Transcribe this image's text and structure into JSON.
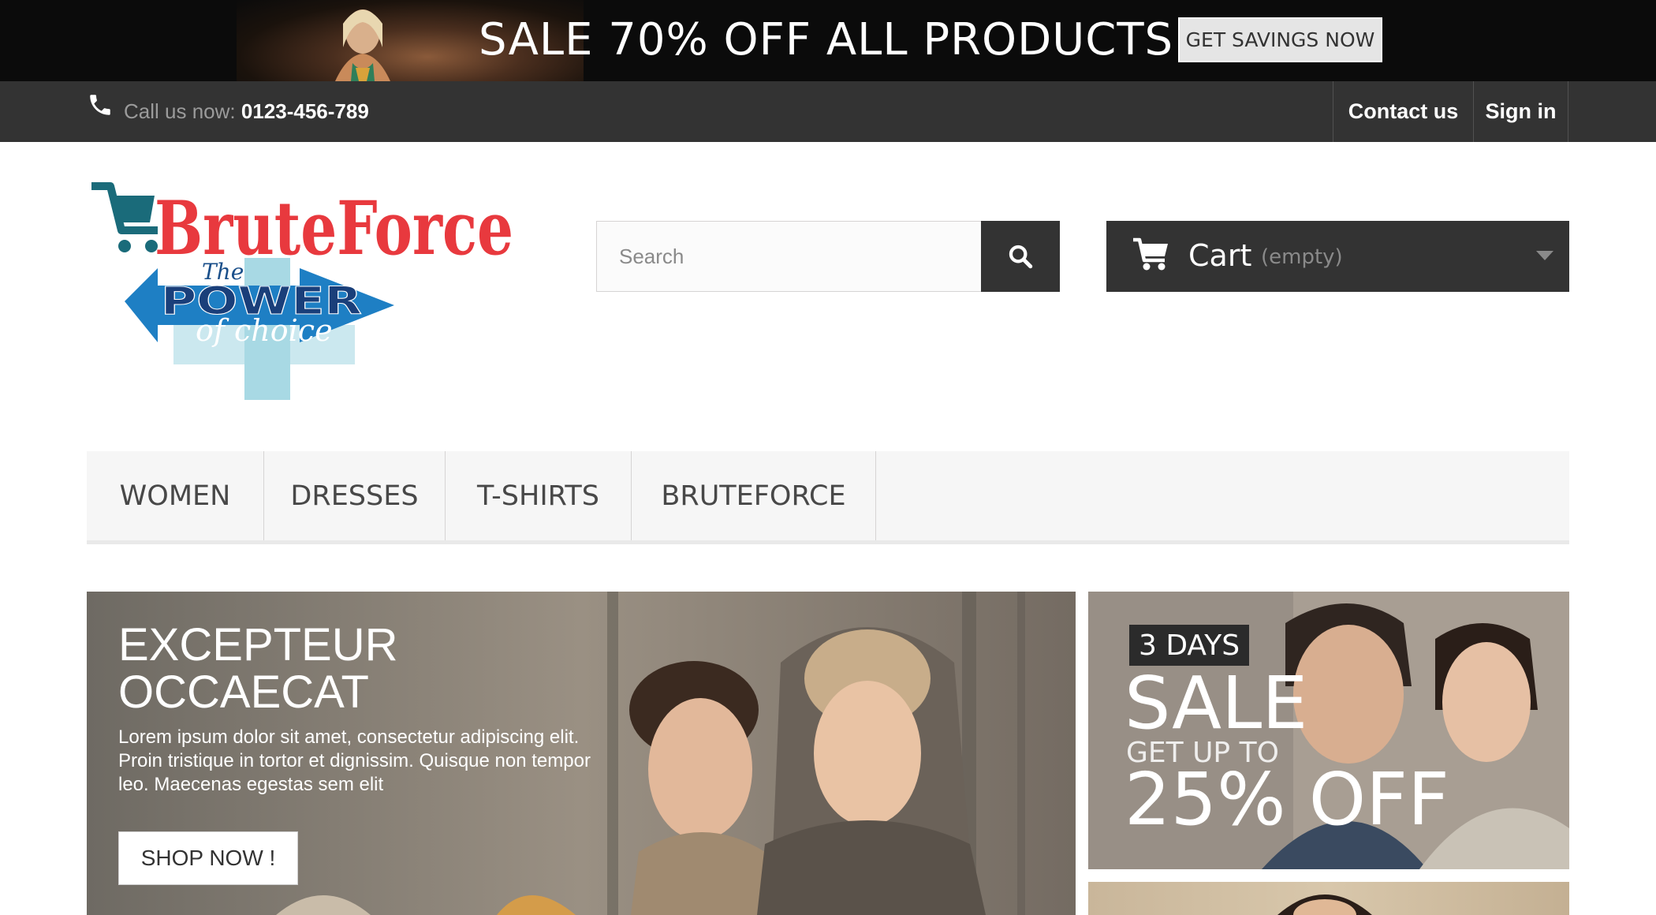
{
  "promo": {
    "text": "SALE 70% OFF ALL PRODUCTS",
    "button_label": "GET SAVINGS NOW"
  },
  "topbar": {
    "call_label": "Call us now:",
    "phone": "0123-456-789",
    "contact_label": "Contact us",
    "signin_label": "Sign in"
  },
  "logo": {
    "brand": "BruteForce",
    "tag_the": "The",
    "tag_power": "POWER",
    "tag_choice": "of choice"
  },
  "search": {
    "placeholder": "Search",
    "value": ""
  },
  "cart": {
    "label": "Cart",
    "status": "(empty)"
  },
  "menu": {
    "items": [
      {
        "label": "WOMEN"
      },
      {
        "label": "DRESSES"
      },
      {
        "label": "T-SHIRTS"
      },
      {
        "label": "BRUTEFORCE"
      }
    ]
  },
  "hero": {
    "title": "EXCEPTEUR OCCAECAT",
    "text": "Lorem ipsum dolor sit amet, consectetur adipiscing elit. Proin tristique in tortor et dignissim. Quisque non tempor leo. Maecenas egestas sem elit",
    "button_label": "SHOP NOW !"
  },
  "side_banner": {
    "days": "3 DAYS",
    "sale": "SALE",
    "get_up_to": "GET UP TO",
    "percent": "25% OFF"
  },
  "colors": {
    "topbar_bg": "#333333",
    "promo_bg": "#0b0b0b",
    "logo_red": "#e8393e",
    "logo_blue": "#1e7fc4",
    "menu_bg": "#f6f6f6"
  },
  "icons": {
    "phone": "phone-icon",
    "search": "search-icon",
    "cart": "cart-icon",
    "caret": "chevron-down-icon"
  }
}
